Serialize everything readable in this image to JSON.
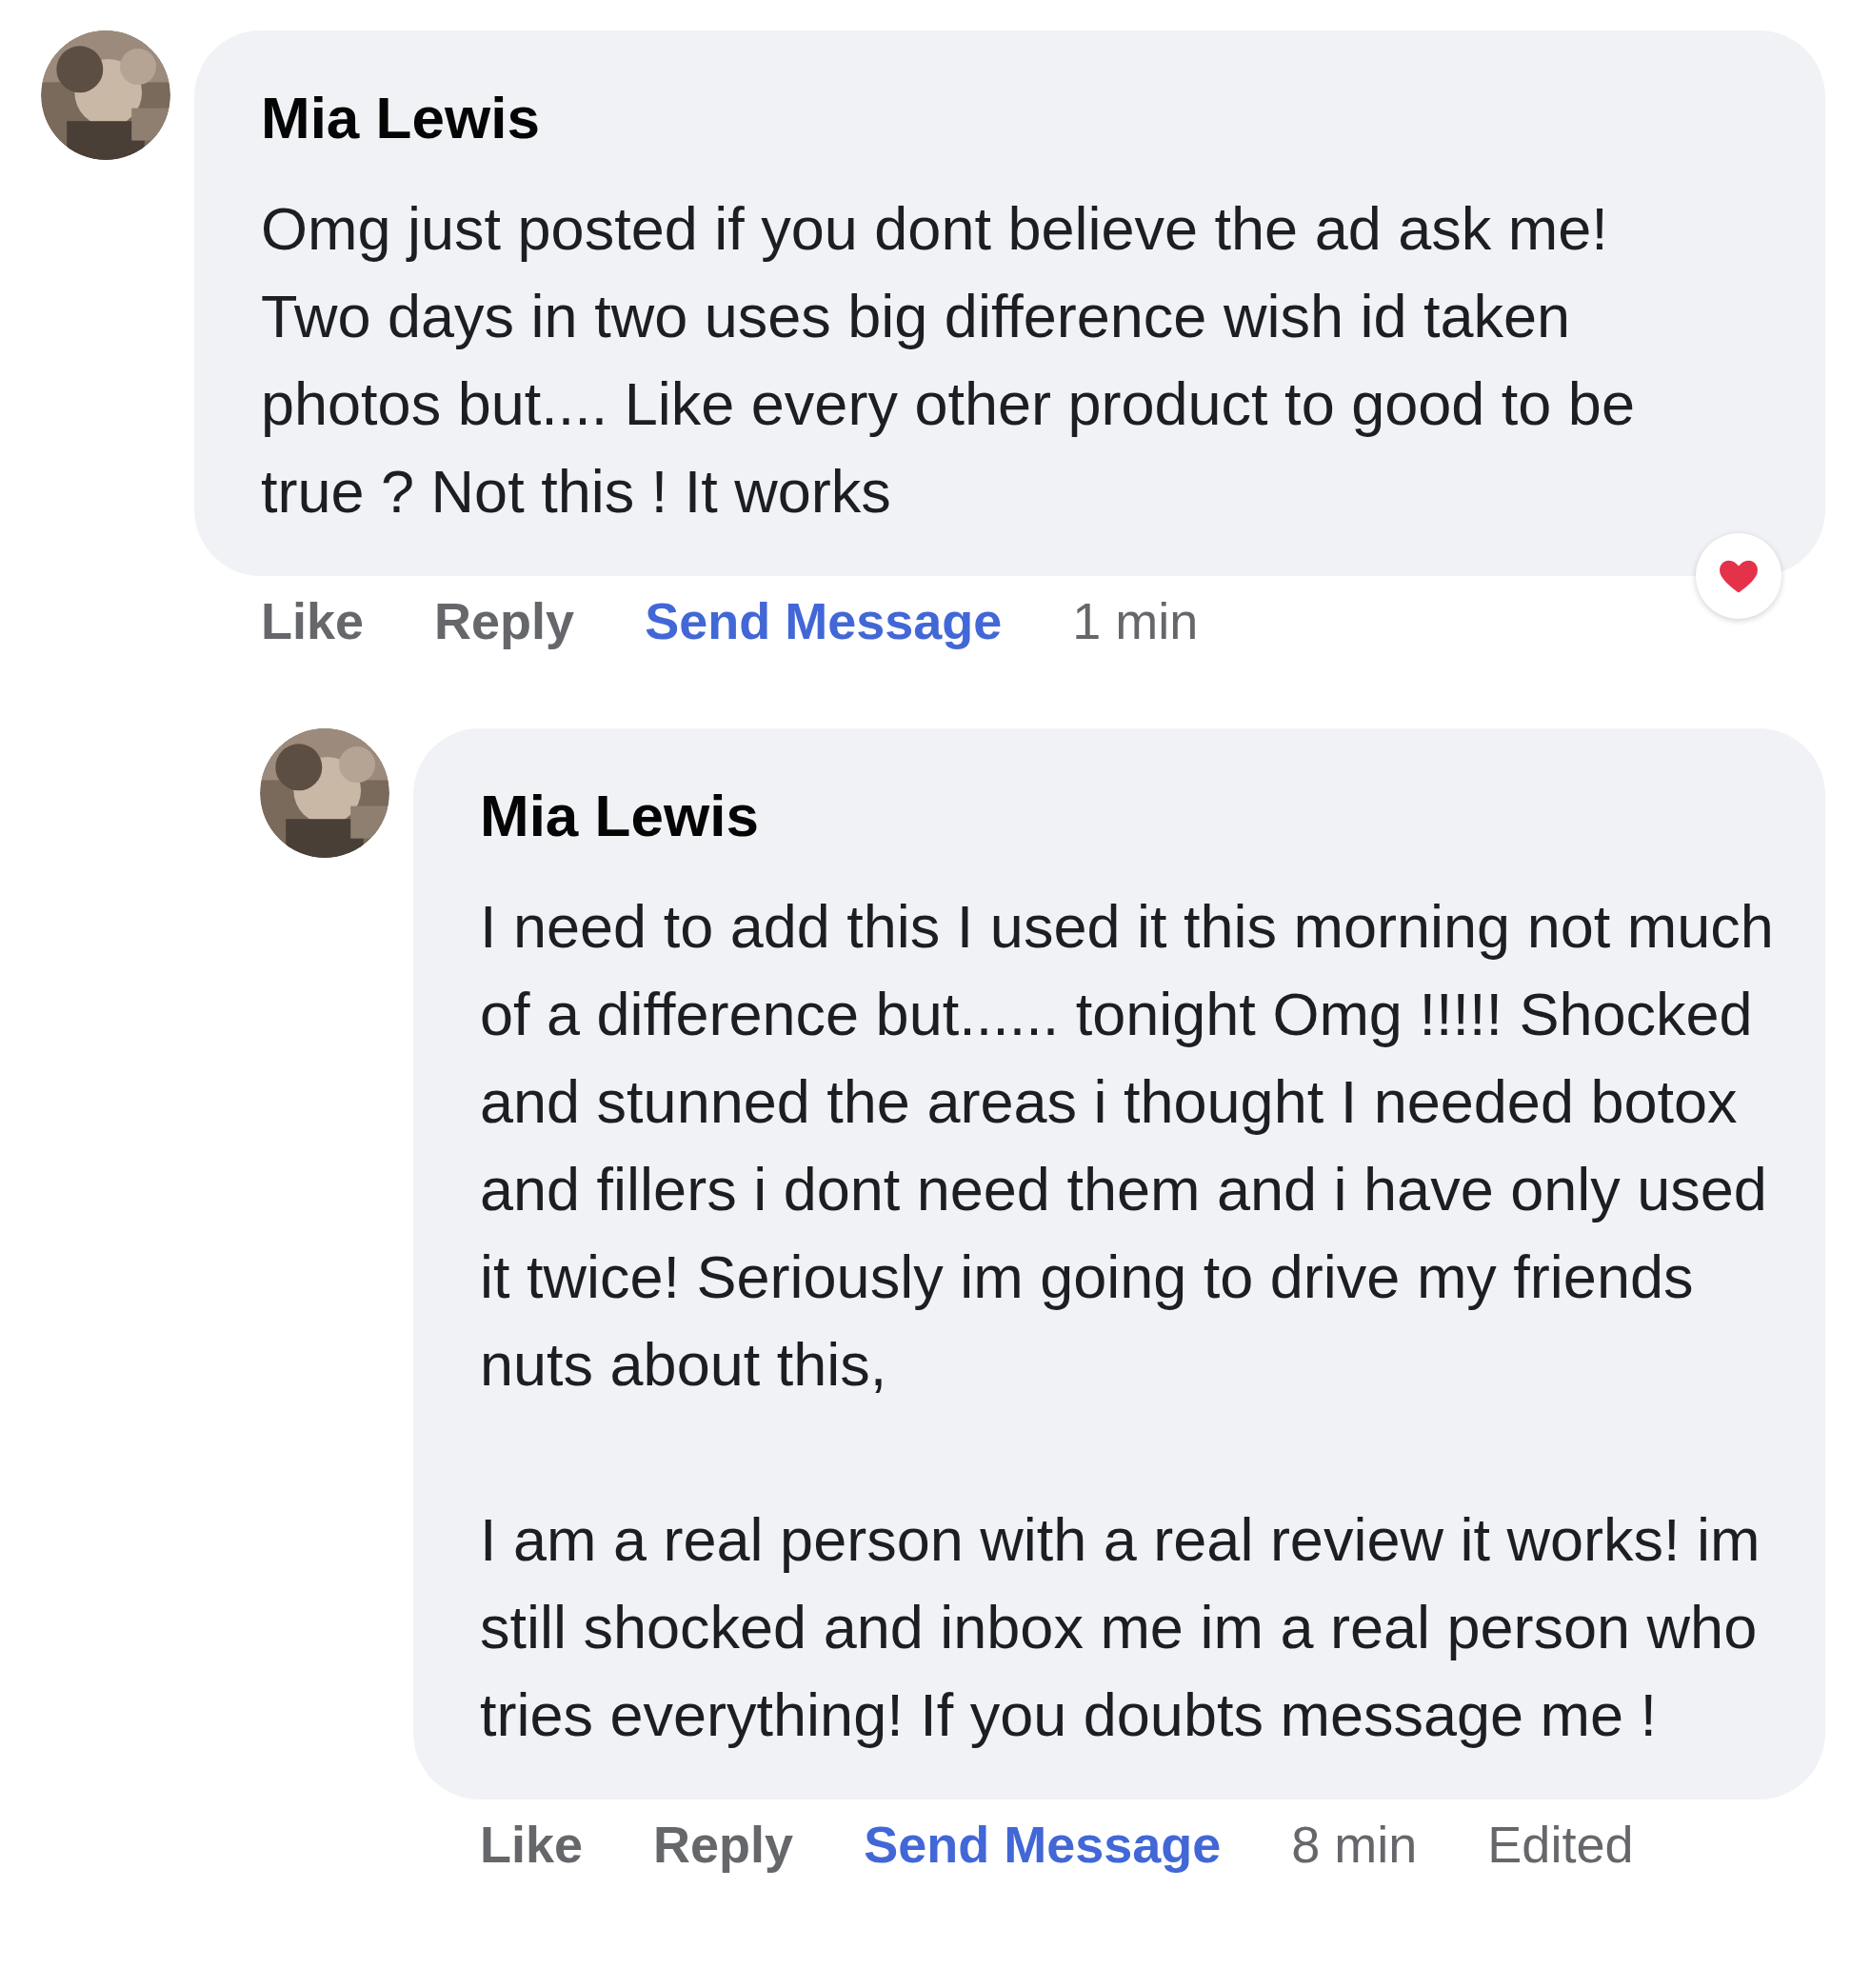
{
  "comments": [
    {
      "author": "Mia Lewis",
      "paragraphs": [
        "Omg just posted if you dont believe the ad ask me! Two days in two uses big difference wish id taken photos but.... Like every other product to good to be true ? Not this ! It works"
      ],
      "actions": [
        {
          "label": "Like",
          "kind": "action"
        },
        {
          "label": "Reply",
          "kind": "action"
        },
        {
          "label": "Send Message",
          "kind": "link"
        },
        {
          "label": "1 min",
          "kind": "meta"
        }
      ],
      "reactions": [
        {
          "kind": "love"
        }
      ],
      "replies": [
        {
          "author": "Mia Lewis",
          "paragraphs": [
            "I need to add this I used it this morning not much of a difference but...... tonight Omg !!!!! Shocked and stunned the areas i thought I needed botox and fillers i dont need them and i have only used it twice! Seriously im going to drive my friends nuts about this,",
            "I am a real person with a real review it works! im still shocked and inbox me im a real person who tries everything! If you doubts message me !"
          ],
          "actions": [
            {
              "label": "Like",
              "kind": "action"
            },
            {
              "label": "Reply",
              "kind": "action"
            },
            {
              "label": "Send Message",
              "kind": "link"
            },
            {
              "label": "8 min",
              "kind": "meta"
            },
            {
              "label": "Edited",
              "kind": "meta"
            }
          ]
        }
      ]
    }
  ]
}
